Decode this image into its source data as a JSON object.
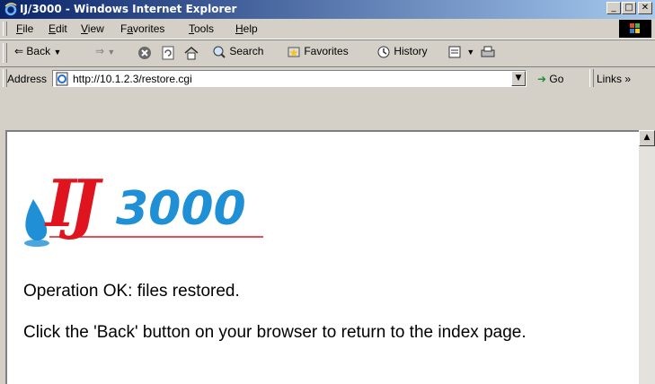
{
  "window": {
    "title": "IJ/3000 - Windows Internet Explorer",
    "minimize": "_",
    "maximize": "□",
    "close": "✕"
  },
  "menu": [
    "File",
    "Edit",
    "View",
    "Favorites",
    "Tools",
    "Help"
  ],
  "menu_underline": [
    "F",
    "E",
    "V",
    "a",
    "T",
    "H"
  ],
  "toolbar": {
    "back": "Back",
    "search": "Search",
    "favorites": "Favorites",
    "history": "History"
  },
  "address": {
    "label": "Address",
    "url": "http://10.1.2.3/restore.cgi",
    "go": "Go",
    "links": "Links »"
  },
  "page": {
    "logo_text": "IJ3000",
    "message1": "Operation OK: files restored.",
    "message2": "Click the 'Back' button on your browser to return to the index page."
  },
  "colors": {
    "titlebar_start": "#0a246a",
    "titlebar_end": "#a6caf0",
    "logo_red": "#e0141e",
    "logo_blue": "#1f8fd6"
  }
}
